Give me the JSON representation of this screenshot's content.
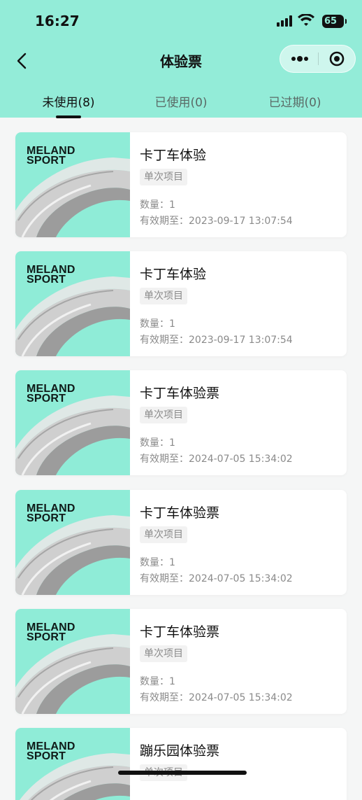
{
  "status_bar": {
    "time": "16:27",
    "battery": "65"
  },
  "nav": {
    "title": "体验票",
    "more_icon": "more-dots-icon",
    "target_icon": "target-circle-icon"
  },
  "tabs": [
    {
      "label": "未使用(8)",
      "active": true
    },
    {
      "label": "已使用(0)",
      "active": false
    },
    {
      "label": "已过期(0)",
      "active": false
    }
  ],
  "thumb_brand": {
    "line1": "MELAND",
    "line2": "SPORT"
  },
  "tickets": [
    {
      "title": "卡丁车体验",
      "tag": "单次项目",
      "quantity": "数量：1",
      "expiry": "有效期至：2023-09-17 13:07:54"
    },
    {
      "title": "卡丁车体验",
      "tag": "单次项目",
      "quantity": "数量：1",
      "expiry": "有效期至：2023-09-17 13:07:54"
    },
    {
      "title": "卡丁车体验票",
      "tag": "单次项目",
      "quantity": "数量：1",
      "expiry": "有效期至：2024-07-05 15:34:02"
    },
    {
      "title": "卡丁车体验票",
      "tag": "单次项目",
      "quantity": "数量：1",
      "expiry": "有效期至：2024-07-05 15:34:02"
    },
    {
      "title": "卡丁车体验票",
      "tag": "单次项目",
      "quantity": "数量：1",
      "expiry": "有效期至：2024-07-05 15:34:02"
    },
    {
      "title": "蹦乐园体验票",
      "tag": "单次项目",
      "quantity": "",
      "expiry": ""
    }
  ],
  "colors": {
    "accent": "#93ecd8",
    "thumb_bg": "#8fecd7",
    "text_primary": "#111111",
    "text_secondary": "#8a8a8a"
  }
}
